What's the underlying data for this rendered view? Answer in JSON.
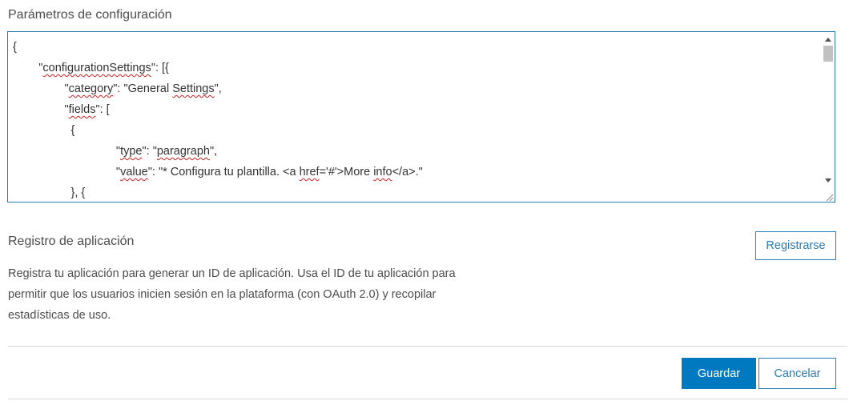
{
  "config": {
    "title": "Parámetros de configuración",
    "code_lines": [
      [
        {
          "t": "{"
        }
      ],
      [
        {
          "t": "        \""
        },
        {
          "t": "configurationSettings",
          "s": true
        },
        {
          "t": "\": [{"
        }
      ],
      [
        {
          "t": "                \""
        },
        {
          "t": "category",
          "s": true
        },
        {
          "t": "\": \"General "
        },
        {
          "t": "Settings",
          "s": true
        },
        {
          "t": "\","
        }
      ],
      [
        {
          "t": "                \""
        },
        {
          "t": "fields",
          "s": true
        },
        {
          "t": "\": ["
        }
      ],
      [
        {
          "t": "                  {"
        }
      ],
      [
        {
          "t": "                                \""
        },
        {
          "t": "type",
          "s": true
        },
        {
          "t": "\": \""
        },
        {
          "t": "paragraph",
          "s": true
        },
        {
          "t": "\","
        }
      ],
      [
        {
          "t": "                                \""
        },
        {
          "t": "value",
          "s": true
        },
        {
          "t": "\": \"* Configura tu plantilla. <a "
        },
        {
          "t": "href",
          "s": true
        },
        {
          "t": "='#'>More "
        },
        {
          "t": "info",
          "s": true
        },
        {
          "t": "</a>.\""
        }
      ],
      [
        {
          "t": "                  }, {"
        }
      ]
    ]
  },
  "registration": {
    "title": "Registro de aplicación",
    "description": "Registra tu aplicación para generar un ID de aplicación. Usa el ID de tu aplicación para permitir que los usuarios inicien sesión en la plataforma (con OAuth 2.0) y recopilar estadísticas de uso.",
    "register_label": "Registrarse"
  },
  "footer": {
    "save_label": "Guardar",
    "cancel_label": "Cancelar"
  },
  "colors": {
    "accent": "#0079c1",
    "border": "#2b7cb4",
    "squiggle": "#d21f1f"
  },
  "icons": [
    "scroll-up-arrow-icon",
    "scroll-down-arrow-icon",
    "resize-grip-icon"
  ]
}
